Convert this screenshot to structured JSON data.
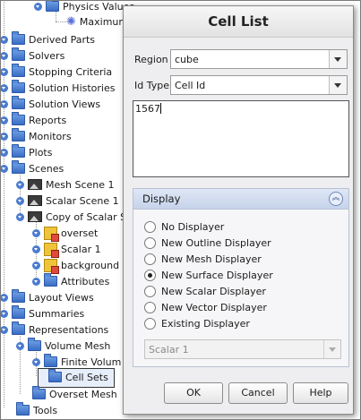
{
  "tree": {
    "physics_values": "Physics Values",
    "maximum": "Maximum",
    "derived_parts": "Derived Parts",
    "solvers": "Solvers",
    "stopping_criteria": "Stopping Criteria",
    "solution_histories": "Solution Histories",
    "solution_views": "Solution Views",
    "reports": "Reports",
    "monitors": "Monitors",
    "plots": "Plots",
    "scenes": "Scenes",
    "mesh_scene": "Mesh Scene 1",
    "scalar_scene": "Scalar Scene 1",
    "copy_of_scalar": "Copy of Scalar Sc",
    "overset": "overset",
    "scalar_1": "Scalar 1",
    "background": "background",
    "attributes": "Attributes",
    "layout_views": "Layout Views",
    "summaries": "Summaries",
    "representations": "Representations",
    "volume_mesh": "Volume Mesh",
    "finite_volume": "Finite Volum",
    "cell_sets": "Cell Sets",
    "overset_mesh": "Overset Mesh",
    "tools": "Tools"
  },
  "dialog": {
    "title": "Cell List",
    "region_label": "Region",
    "region_value": "cube",
    "idtype_label": "Id Type",
    "idtype_value": "Cell Id",
    "id_text": "1567",
    "display_header": "Display",
    "options": [
      "No Displayer",
      "New Outline Displayer",
      "New Mesh Displayer",
      "New Surface Displayer",
      "New Scalar Displayer",
      "New Vector Displayer",
      "Existing Displayer"
    ],
    "selected_option": "New Surface Displayer",
    "existing_value": "Scalar 1",
    "ok": "OK",
    "cancel": "Cancel",
    "help": "Help"
  }
}
